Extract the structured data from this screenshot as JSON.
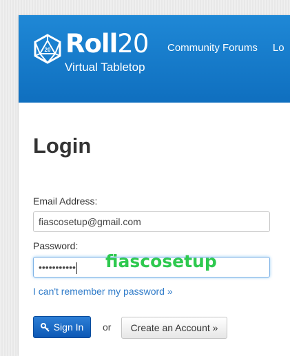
{
  "header": {
    "logo_word_bold": "Roll",
    "logo_word_light": "20",
    "logo_die_number": "20",
    "logo_tagline": "Virtual Tabletop",
    "nav_items": [
      "Community Forums",
      "Lo"
    ]
  },
  "main": {
    "title": "Login",
    "email_label": "Email Address:",
    "email_value": "fiascosetup@gmail.com",
    "password_label": "Password:",
    "password_value": "•••••••••••",
    "password_annotation": "fiascosetup",
    "forgot_link": "I can't remember my password »",
    "signin_label": "Sign In",
    "or_text": "or",
    "create_account_label": "Create an Account »"
  },
  "colors": {
    "header_blue": "#1479cc",
    "link_blue": "#2f7bc9",
    "annotation_green": "#2ec94f",
    "button_blue": "#0c58b5"
  },
  "icons": [
    "d20-logo-icon",
    "key-icon"
  ]
}
